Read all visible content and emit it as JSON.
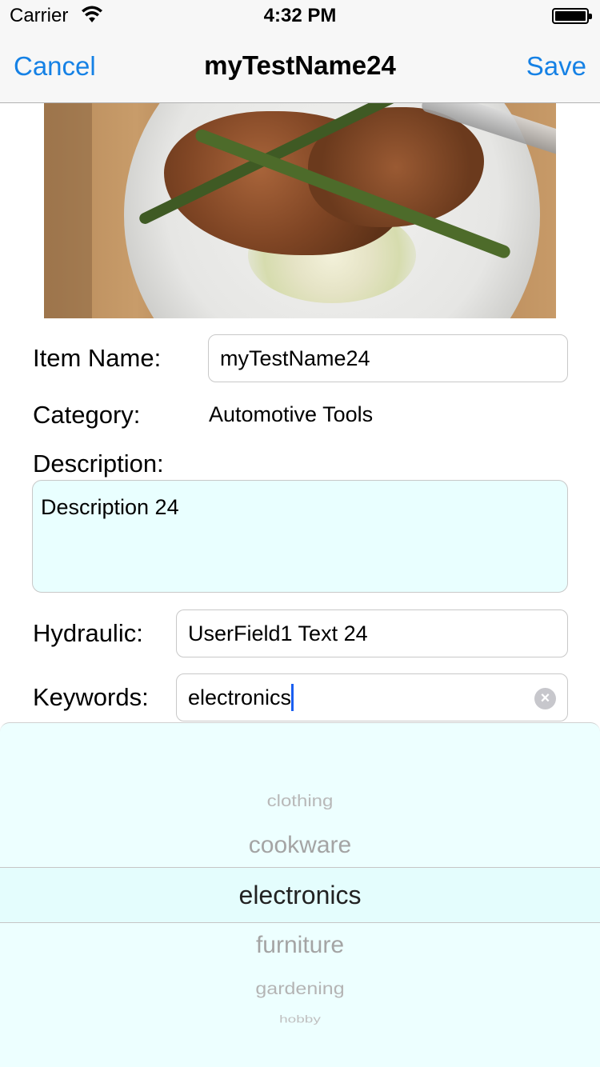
{
  "status_bar": {
    "carrier": "Carrier",
    "time": "4:32 PM"
  },
  "nav": {
    "cancel_label": "Cancel",
    "title": "myTestName24",
    "save_label": "Save"
  },
  "form": {
    "item_name_label": "Item Name:",
    "item_name_value": "myTestName24",
    "category_label": "Category:",
    "category_value": "Automotive Tools",
    "description_label": "Description:",
    "description_value": "Description 24",
    "hydraulic_label": "Hydraulic:",
    "hydraulic_value": "UserField1 Text 24",
    "keywords_label": "Keywords:",
    "keywords_value": "electronics"
  },
  "picker": {
    "options": [
      "clothing",
      "cookware",
      "electronics",
      "furniture",
      "gardening",
      "hobby"
    ],
    "selected": "electronics"
  }
}
